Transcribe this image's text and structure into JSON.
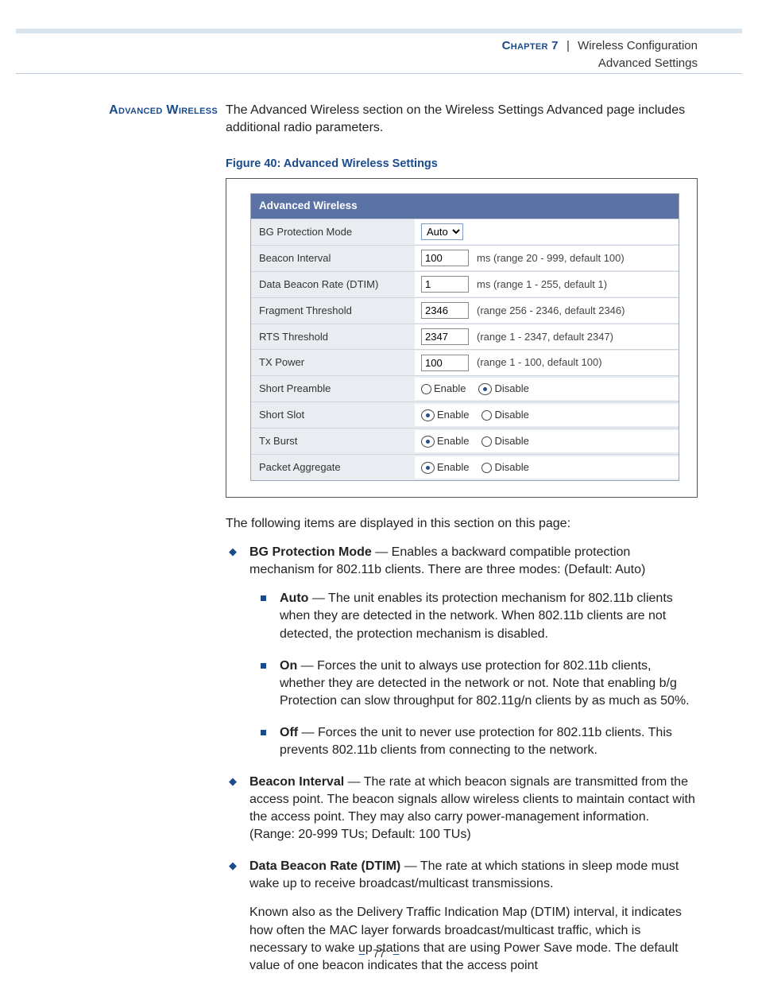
{
  "header": {
    "chapter": "Chapter 7",
    "sep": "|",
    "title1": "Wireless Configuration",
    "title2": "Advanced Settings"
  },
  "sidehead": "Advanced Wireless",
  "intro": "The Advanced Wireless section on the Wireless Settings Advanced page includes additional radio parameters.",
  "figcaption": "Figure 40:  Advanced Wireless Settings",
  "panel": {
    "title": "Advanced Wireless",
    "bg_label": "BG Protection Mode",
    "bg_value": "Auto",
    "beacon_label": "Beacon Interval",
    "beacon_value": "100",
    "beacon_hint": "ms (range 20 - 999, default 100)",
    "dtim_label": "Data Beacon Rate (DTIM)",
    "dtim_value": "1",
    "dtim_hint": "ms (range 1 - 255, default 1)",
    "frag_label": "Fragment Threshold",
    "frag_value": "2346",
    "frag_hint": "(range 256 - 2346, default 2346)",
    "rts_label": "RTS Threshold",
    "rts_value": "2347",
    "rts_hint": "(range 1 - 2347, default 2347)",
    "txp_label": "TX Power",
    "txp_value": "100",
    "txp_hint": "(range 1 - 100, default 100)",
    "preamble_label": "Short Preamble",
    "slot_label": "Short Slot",
    "burst_label": "Tx Burst",
    "agg_label": "Packet Aggregate",
    "enable": "Enable",
    "disable": "Disable"
  },
  "para1": "The following items are displayed in this section on this page:",
  "items": {
    "bg_t": "BG Protection Mode",
    "bg_d": " — Enables a backward compatible protection mechanism for 802.11b clients. There are three modes: (Default: Auto)",
    "auto_t": "Auto",
    "auto_d": " — The unit enables its protection mechanism for 802.11b clients when they are detected in the network. When 802.11b clients are not detected, the protection mechanism is disabled.",
    "on_t": "On",
    "on_d": " — Forces the unit to always use protection for 802.11b clients, whether they are detected in the network or not. Note that enabling b/g Protection can slow throughput for 802.11g/n clients by as much as 50%.",
    "off_t": "Off",
    "off_d": " — Forces the unit to never use protection for 802.11b clients. This prevents 802.11b clients from connecting to the network.",
    "beacon_t": "Beacon Interval",
    "beacon_d": " — The rate at which beacon signals are transmitted from the access point. The beacon signals allow wireless clients to maintain contact with the access point. They may also carry power-management information. (Range: 20-999 TUs; Default: 100 TUs)",
    "dtim_t": "Data Beacon Rate (DTIM)",
    "dtim_d": " — The rate at which stations in sleep mode must wake up to receive broadcast/multicast transmissions.",
    "dtim_p2": "Known also as the Delivery Traffic Indication Map (DTIM) interval, it indicates how often the MAC layer forwards broadcast/multicast traffic, which is necessary to wake up stations that are using Power Save mode. The default value of one beacon indicates that the access point"
  },
  "footer": {
    "dash": "–",
    "page": "77"
  }
}
